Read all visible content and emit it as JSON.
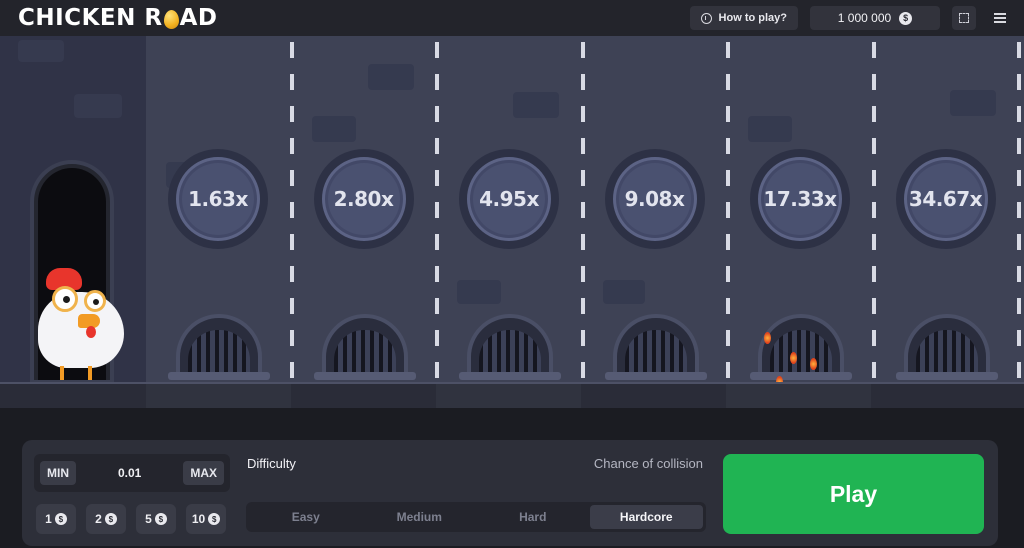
{
  "header": {
    "logo_left": "CHICKEN R",
    "logo_right": "AD",
    "how_to_play": "How to play?",
    "balance": "1 000 000",
    "currency_symbol": "$"
  },
  "lanes": [
    {
      "multiplier": "1.63x",
      "hazard": false
    },
    {
      "multiplier": "2.80x",
      "hazard": false
    },
    {
      "multiplier": "4.95x",
      "hazard": false
    },
    {
      "multiplier": "9.08x",
      "hazard": false
    },
    {
      "multiplier": "17.33x",
      "hazard": true
    },
    {
      "multiplier": "34.67x",
      "hazard": false
    }
  ],
  "controls": {
    "min_label": "MIN",
    "max_label": "MAX",
    "bet_value": "0.01",
    "quick_bets": [
      "1",
      "2",
      "5",
      "10"
    ],
    "difficulty_label": "Difficulty",
    "chance_label": "Chance of collision",
    "difficulties": [
      "Easy",
      "Medium",
      "Hard",
      "Hardcore"
    ],
    "selected_difficulty": "Hardcore",
    "play_label": "Play"
  },
  "colors": {
    "play_green": "#20b453",
    "scene_bg": "#3e4255",
    "panel_bg": "#2d2f39"
  }
}
